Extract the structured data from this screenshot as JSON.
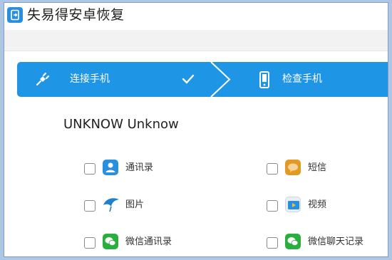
{
  "app": {
    "title": "失易得安卓恢复"
  },
  "steps": {
    "connect_label": "连接手机",
    "check_label": "检查手机"
  },
  "device": {
    "name": "UNKNOW Unknow"
  },
  "options": {
    "contacts": "通讯录",
    "sms": "短信",
    "images": "图片",
    "video": "视频",
    "wechat_contacts": "微信通讯录",
    "wechat_chat": "微信聊天记录"
  },
  "colors": {
    "accent": "#1f95e6",
    "wechat_green": "#2aae3d",
    "contacts_blue": "#2b8fe0",
    "sms_orange": "#e39a24"
  }
}
